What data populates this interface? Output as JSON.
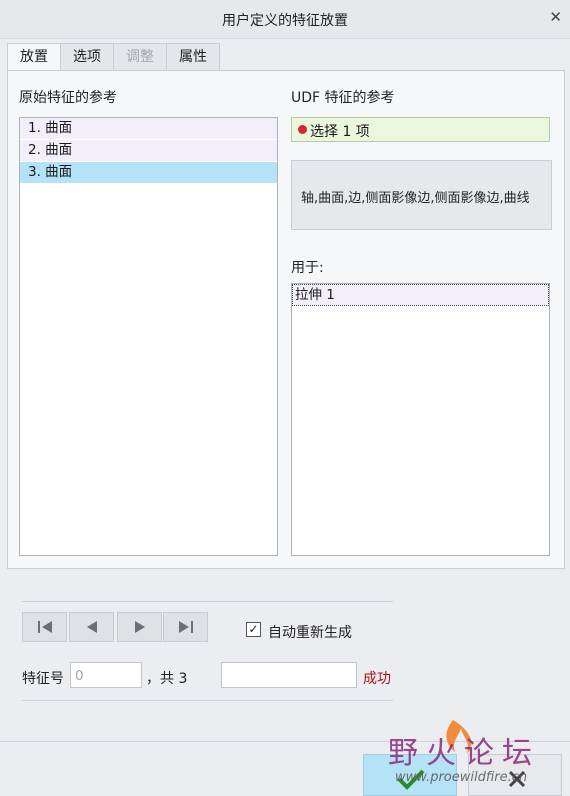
{
  "window": {
    "title": "用户定义的特征放置"
  },
  "tabs": [
    {
      "label": "放置"
    },
    {
      "label": "选项"
    },
    {
      "label": "调整"
    },
    {
      "label": "属性"
    }
  ],
  "placement": {
    "original_refs_label": "原始特征的参考",
    "original_refs": [
      "1. 曲面",
      "2. 曲面",
      "3. 曲面"
    ],
    "udf_refs_label": "UDF 特征的参考",
    "selection_text": "选择 1 项",
    "ref_types_text": "轴,曲面,边,侧面影像边,侧面影像边,曲线",
    "used_for_label": "用于:",
    "used_for_items": [
      "拉伸 1"
    ]
  },
  "controls": {
    "auto_regen_label": "自动重新生成",
    "auto_regen_checked": true,
    "feature_no_label": "特征号",
    "feature_no_placeholder": "0",
    "total_text": "，共 3",
    "status_text": "成功"
  },
  "watermark": {
    "title": "野火论坛",
    "url": "www.proewildfire.cn"
  },
  "colors": {
    "selected_row": "#b4e2f7",
    "selection_field": "#ebf7dd",
    "status": "#a31515",
    "dot": "#d8262c"
  }
}
